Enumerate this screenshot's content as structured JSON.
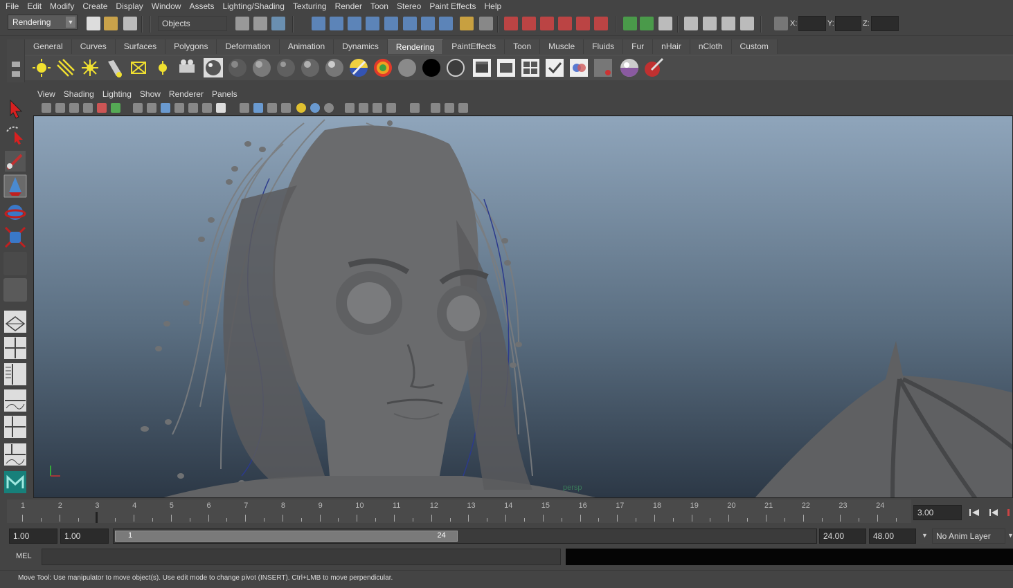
{
  "menu": [
    "File",
    "Edit",
    "Modify",
    "Create",
    "Display",
    "Window",
    "Assets",
    "Lighting/Shading",
    "Texturing",
    "Render",
    "Toon",
    "Stereo",
    "Paint Effects",
    "Help"
  ],
  "status_line": {
    "menu_set": "Rendering",
    "selection_mode": "Objects",
    "x_label": "X:",
    "y_label": "Y:",
    "z_label": "Z:",
    "x_value": "",
    "y_value": "",
    "z_value": ""
  },
  "shelf": {
    "tabs": [
      "General",
      "Curves",
      "Surfaces",
      "Polygons",
      "Deformation",
      "Animation",
      "Dynamics",
      "Rendering",
      "PaintEffects",
      "Toon",
      "Muscle",
      "Fluids",
      "Fur",
      "nHair",
      "nCloth",
      "Custom"
    ],
    "active_tab": "Rendering"
  },
  "panel": {
    "menus": [
      "View",
      "Shading",
      "Lighting",
      "Show",
      "Renderer",
      "Panels"
    ],
    "camera_label": "persp"
  },
  "time_slider": {
    "ticks": [
      1,
      2,
      3,
      4,
      5,
      6,
      7,
      8,
      9,
      10,
      11,
      12,
      13,
      14,
      15,
      16,
      17,
      18,
      19,
      20,
      21,
      22,
      23,
      24
    ],
    "current_time": "3.00",
    "current_frame": 3
  },
  "range": {
    "start": "1.00",
    "playback_start": "1.00",
    "handle_start_label": "1",
    "handle_end_label": "24",
    "playback_end": "24.00",
    "end": "48.00",
    "anim_layer": "No Anim Layer"
  },
  "command_line": {
    "label": "MEL",
    "input": ""
  },
  "help_line": {
    "text": "Move Tool: Use manipulator to move object(s). Use edit mode to change pivot (INSERT).  Ctrl+LMB to move perpendicular."
  }
}
